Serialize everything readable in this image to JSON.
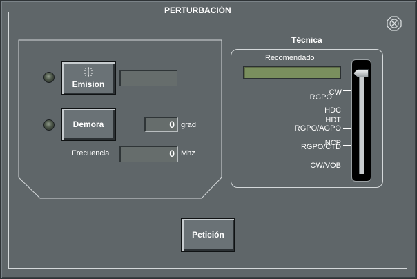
{
  "window": {
    "title": "PERTURBACIÓN"
  },
  "controls": {
    "emision": {
      "button_label": "Emision",
      "value": ""
    },
    "demora": {
      "button_label": "Demora",
      "value": "0",
      "unit": "grad"
    },
    "frecuencia": {
      "label": "Frecuencia",
      "value": "0",
      "unit": "Mhz"
    }
  },
  "tecnica": {
    "title": "Técnica",
    "recommended_label": "Recomendado",
    "slider_options": [
      {
        "upper": "CW",
        "lower": "RGPO"
      },
      {
        "upper": "",
        "lower": "HDC"
      },
      {
        "upper": "HDT",
        "lower": "RGPO/AGPO"
      },
      {
        "upper": "NCP",
        "lower": "RGPO/CTD"
      },
      {
        "upper": "",
        "lower": "CW/VOB"
      }
    ],
    "slider_position": 0
  },
  "footer": {
    "request_button_label": "Petición"
  },
  "icons": {
    "close": "close-icon",
    "select_target": "crosshair-icon"
  },
  "colors": {
    "background": "#5f6669",
    "recommended_fill": "#7a8f5e",
    "frame_line": "#d4d8da"
  }
}
